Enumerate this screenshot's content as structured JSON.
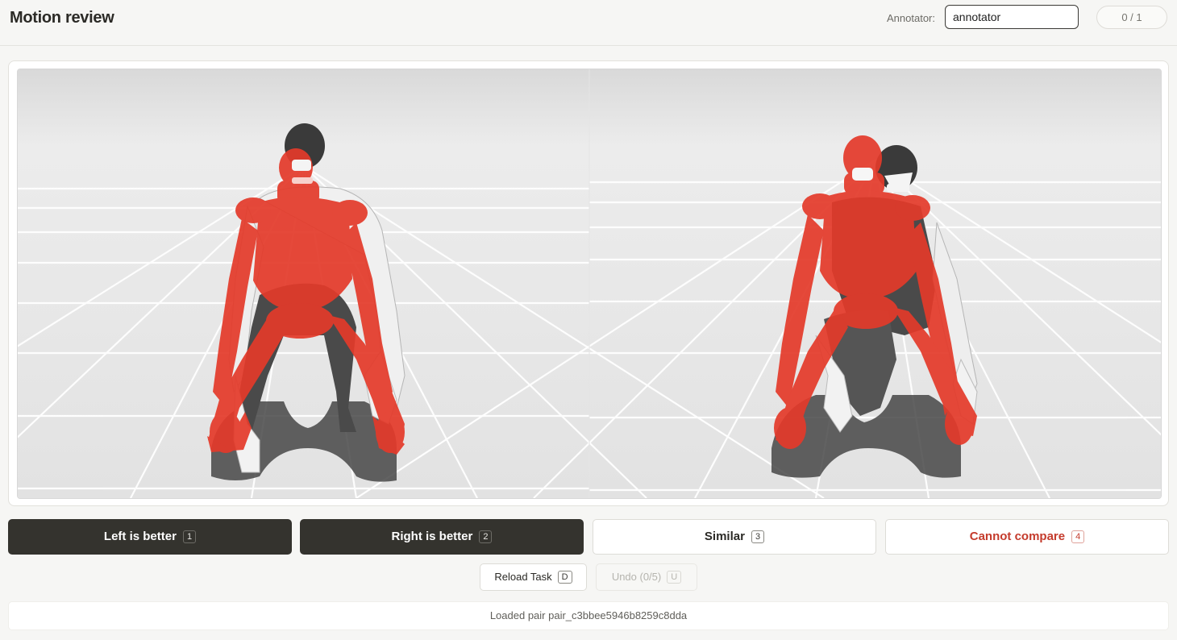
{
  "header": {
    "title": "Motion review",
    "annotator_label": "Annotator:",
    "annotator_value": "annotator",
    "progress": "0 / 1"
  },
  "viewer": {
    "scene": "two robot motion clips side by side on a gridded floor",
    "colors": {
      "floor": "#e6e6e6",
      "grid": "#ffffff",
      "robot_red": "#e43a2a",
      "robot_white": "#f2f2f2",
      "robot_dark": "#3c3c3c",
      "shadow": "#4a4a4a"
    }
  },
  "actions": {
    "left_better": {
      "label": "Left is better",
      "key": "1"
    },
    "right_better": {
      "label": "Right is better",
      "key": "2"
    },
    "similar": {
      "label": "Similar",
      "key": "3"
    },
    "cannot_compare": {
      "label": "Cannot compare",
      "key": "4"
    }
  },
  "secondary": {
    "reload": {
      "label": "Reload Task",
      "key": "D"
    },
    "undo": {
      "label": "Undo (0/5)",
      "key": "U"
    }
  },
  "status": {
    "message": "Loaded pair pair_c3bbee5946b8259c8dda"
  }
}
